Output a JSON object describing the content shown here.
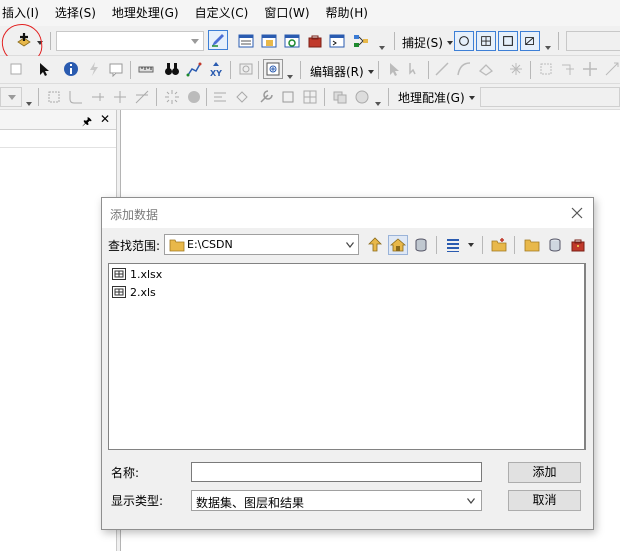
{
  "menubar": {
    "items": [
      "插入(I)",
      "选择(S)",
      "地理处理(G)",
      "自定义(C)",
      "窗口(W)",
      "帮助(H)"
    ]
  },
  "toolbar": {
    "snapping_label": "捕捉(S)",
    "editor_label": "编辑器(R)",
    "georeferencing_label": "地理配准(G)"
  },
  "icons": {
    "add_data": "add-data-icon",
    "select": "select-arrow-icon",
    "identify": "identify-icon",
    "find": "binoculars-icon",
    "go_to_xy": "go-to-xy-icon"
  },
  "colors": {
    "annotation_circle": "#e21f1f",
    "snap_active": "#3d7fd6",
    "folder": "#e8b84a"
  },
  "dialog": {
    "title": "添加数据",
    "look_in_label": "查找范围:",
    "look_in_value": "E:\\CSDN",
    "files": [
      {
        "name": "1.xlsx"
      },
      {
        "name": "2.xls"
      }
    ],
    "name_label": "名称:",
    "name_value": "",
    "type_label": "显示类型:",
    "type_value": "数据集、图层和结果",
    "add_button": "添加",
    "cancel_button": "取消"
  }
}
